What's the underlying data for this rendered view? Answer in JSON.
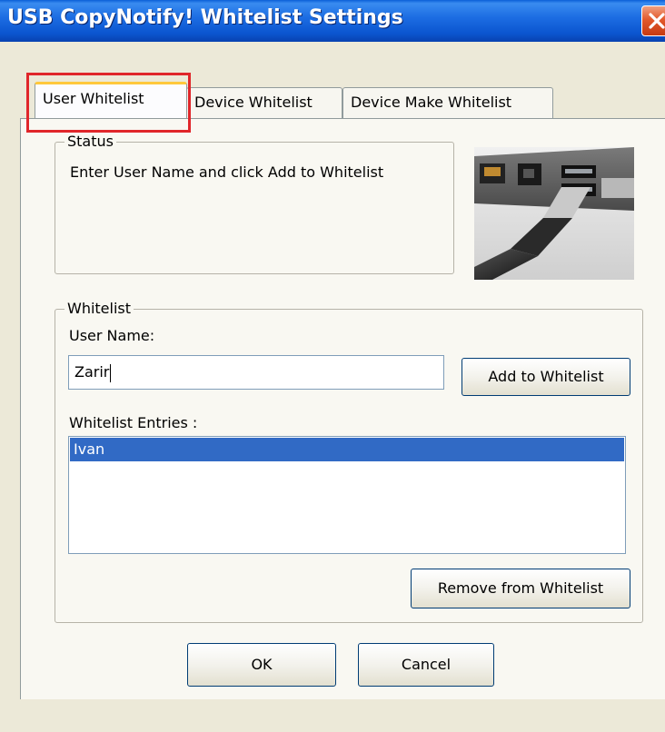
{
  "window": {
    "title": "USB CopyNotify! Whitelist Settings"
  },
  "tabs": [
    {
      "label": "User Whitelist",
      "active": true
    },
    {
      "label": "Device Whitelist",
      "active": false
    },
    {
      "label": "Device Make Whitelist",
      "active": false
    }
  ],
  "status_group": {
    "legend": "Status",
    "message": "Enter User Name and click Add to Whitelist"
  },
  "whitelist_group": {
    "legend": "Whitelist",
    "user_name_label": "User Name:",
    "user_name_value": "Zarir",
    "add_button": "Add to Whitelist",
    "entries_label": "Whitelist Entries :",
    "entries": [
      "Ivan"
    ],
    "selected_entry": "Ivan",
    "remove_button": "Remove from Whitelist"
  },
  "footer": {
    "ok_button": "OK",
    "cancel_button": "Cancel"
  },
  "colors": {
    "titlebar": "#0b55d0",
    "selection": "#316ac5",
    "highlight_box": "#e0262a",
    "dialog_bg": "#ece9d8"
  },
  "icons": [
    "close-icon",
    "usb-ports-image"
  ]
}
